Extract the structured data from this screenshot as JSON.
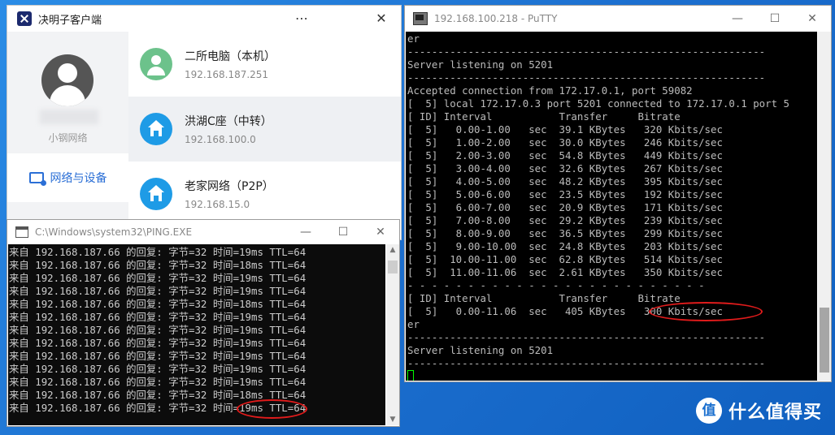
{
  "client": {
    "title": "决明子客户端",
    "more_icon": "⋯",
    "close_icon": "✕",
    "username": "小钢网络",
    "nav_label": "网络与设备",
    "devices": [
      {
        "name": "二所电脑（本机）",
        "ip": "192.168.187.251",
        "icon": "person-icon",
        "color": "#6cc28b"
      },
      {
        "name": "洪湖C座（中转）",
        "ip": "192.168.100.0",
        "icon": "home-icon",
        "color": "#1e9be6"
      },
      {
        "name": "老家网络（P2P）",
        "ip": "192.168.15.0",
        "icon": "home-icon",
        "color": "#1e9be6"
      }
    ]
  },
  "putty": {
    "title": "192.168.100.218 - PuTTY",
    "minimize": "—",
    "maximize": "☐",
    "close": "✕",
    "lines": [
      "er",
      "-----------------------------------------------------------",
      "Server listening on 5201",
      "-----------------------------------------------------------",
      "Accepted connection from 172.17.0.1, port 59082",
      "[  5] local 172.17.0.3 port 5201 connected to 172.17.0.1 port 5",
      "[ ID] Interval           Transfer     Bitrate",
      "[  5]   0.00-1.00   sec  39.1 KBytes   320 Kbits/sec",
      "[  5]   1.00-2.00   sec  30.0 KBytes   246 Kbits/sec",
      "[  5]   2.00-3.00   sec  54.8 KBytes   449 Kbits/sec",
      "[  5]   3.00-4.00   sec  32.6 KBytes   267 Kbits/sec",
      "[  5]   4.00-5.00   sec  48.2 KBytes   395 Kbits/sec",
      "[  5]   5.00-6.00   sec  23.5 KBytes   192 Kbits/sec",
      "[  5]   6.00-7.00   sec  20.9 KBytes   171 Kbits/sec",
      "[  5]   7.00-8.00   sec  29.2 KBytes   239 Kbits/sec",
      "[  5]   8.00-9.00   sec  36.5 KBytes   299 Kbits/sec",
      "[  5]   9.00-10.00  sec  24.8 KBytes   203 Kbits/sec",
      "[  5]  10.00-11.00  sec  62.8 KBytes   514 Kbits/sec",
      "[  5]  11.00-11.06  sec  2.61 KBytes   350 Kbits/sec",
      "- - - - - - - - - - - - - - - - - - - - - - - - -",
      "[ ID] Interval           Transfer     Bitrate",
      "[  5]   0.00-11.06  sec   405 KBytes   300 Kbits/sec",
      "er",
      "-----------------------------------------------------------",
      "Server listening on 5201",
      "-----------------------------------------------------------"
    ]
  },
  "ping": {
    "title": "C:\\Windows\\system32\\PING.EXE",
    "minimize": "—",
    "maximize": "☐",
    "close": "✕",
    "lines": [
      "来自 192.168.187.66 的回复: 字节=32 时间=19ms TTL=64",
      "来自 192.168.187.66 的回复: 字节=32 时间=18ms TTL=64",
      "来自 192.168.187.66 的回复: 字节=32 时间=19ms TTL=64",
      "来自 192.168.187.66 的回复: 字节=32 时间=19ms TTL=64",
      "来自 192.168.187.66 的回复: 字节=32 时间=18ms TTL=64",
      "来自 192.168.187.66 的回复: 字节=32 时间=19ms TTL=64",
      "来自 192.168.187.66 的回复: 字节=32 时间=19ms TTL=64",
      "来自 192.168.187.66 的回复: 字节=32 时间=19ms TTL=64",
      "来自 192.168.187.66 的回复: 字节=32 时间=19ms TTL=64",
      "来自 192.168.187.66 的回复: 字节=32 时间=19ms TTL=64",
      "来自 192.168.187.66 的回复: 字节=32 时间=19ms TTL=64",
      "来自 192.168.187.66 的回复: 字节=32 时间=18ms TTL=64",
      "来自 192.168.187.66 的回复: 字节=32 时间=19ms TTL=64"
    ]
  },
  "watermark": {
    "text": "什么值得买"
  }
}
